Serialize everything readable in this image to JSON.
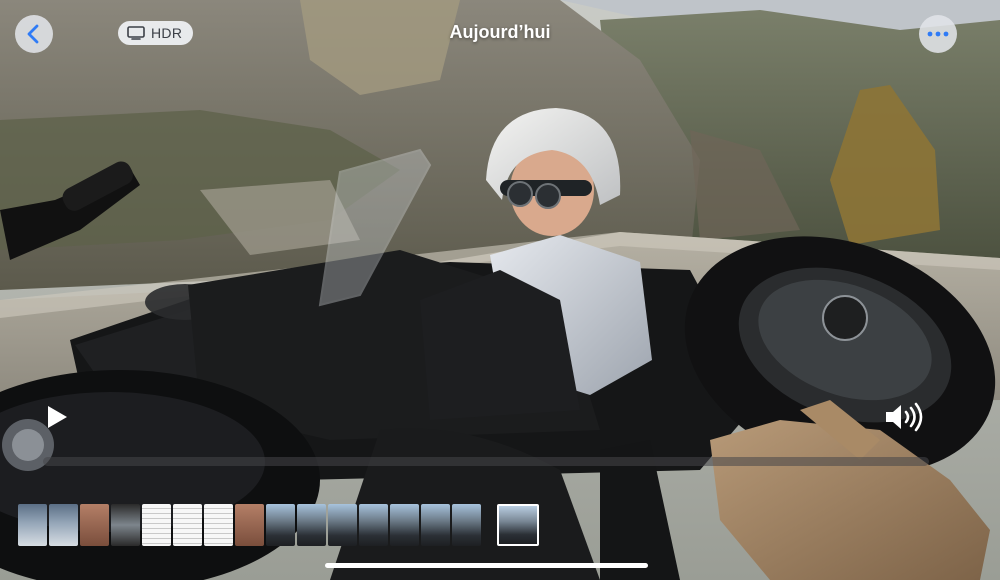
{
  "header": {
    "title": "Aujourd’hui",
    "hdr_label": "HDR"
  },
  "icons": {
    "back": "chevron-left-icon",
    "hdr": "display-icon",
    "more": "ellipsis-icon",
    "play": "play-icon",
    "volume": "speaker-wave-icon"
  },
  "player": {
    "state": "paused",
    "progress": 0
  },
  "filmstrip": {
    "thumbnails": [
      {
        "kind": "screenshot"
      },
      {
        "kind": "screenshot"
      },
      {
        "kind": "photo"
      },
      {
        "kind": "screen"
      },
      {
        "kind": "document"
      },
      {
        "kind": "document"
      },
      {
        "kind": "document"
      },
      {
        "kind": "photo"
      },
      {
        "kind": "sidecar"
      },
      {
        "kind": "sidecar"
      },
      {
        "kind": "sidecar"
      },
      {
        "kind": "sidecar"
      },
      {
        "kind": "sidecar"
      },
      {
        "kind": "sidecar"
      },
      {
        "kind": "sidecar"
      }
    ],
    "selected": {
      "kind": "sidecar-video"
    }
  },
  "colors": {
    "accent": "#2f7bf6",
    "button_bg": "#e1e4e8"
  }
}
